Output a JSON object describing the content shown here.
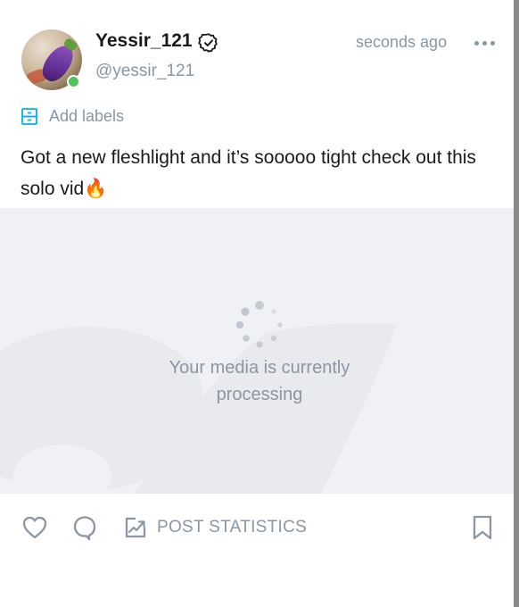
{
  "author": {
    "display_name": "Yessir_121",
    "handle": "@yessir_121",
    "verified": true,
    "online": true
  },
  "post": {
    "timestamp": "seconds ago",
    "add_labels": "Add labels",
    "text": "Got a new fleshlight and it’s sooooo tight check out this solo vid",
    "emoji": "🔥"
  },
  "media": {
    "status_text": "Your media is currently processing"
  },
  "actions": {
    "stats_label": "POST STATISTICS"
  },
  "colors": {
    "muted_text": "#8a96a3",
    "accent_blue": "#00aff0",
    "online_green": "#4cc35b",
    "media_bg": "#f0f1f4"
  },
  "icons": [
    "verified-icon",
    "more-icon",
    "label-icon",
    "spinner-icon",
    "heart-icon",
    "comment-icon",
    "stats-icon",
    "bookmark-icon"
  ]
}
